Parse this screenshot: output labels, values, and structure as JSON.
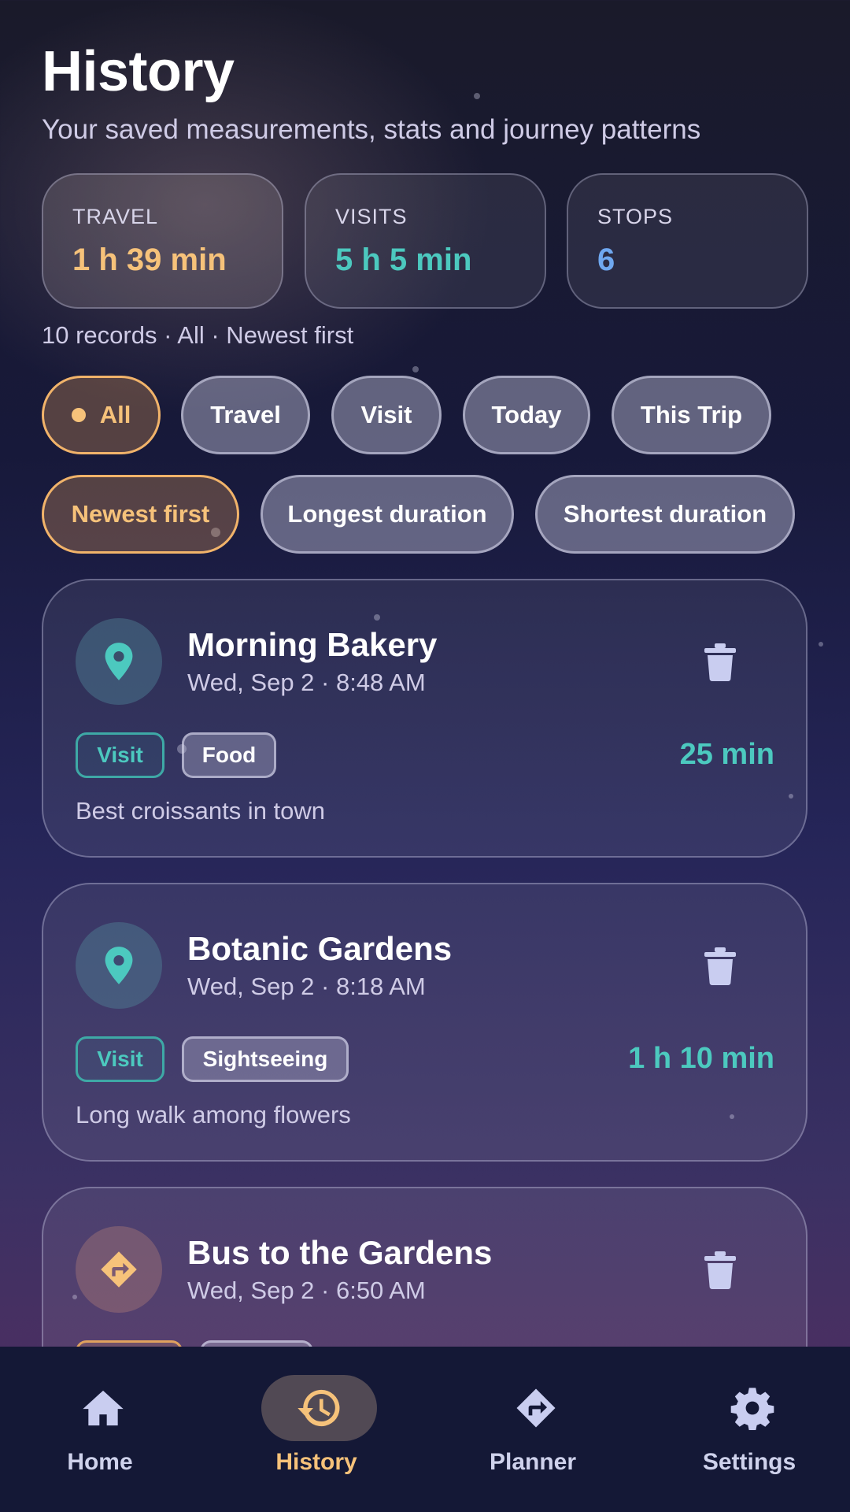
{
  "header": {
    "title": "History",
    "subtitle": "Your saved measurements, stats and journey patterns"
  },
  "stats": [
    {
      "label": "TRAVEL",
      "value": "1 h 39 min",
      "color": "#f6c27a"
    },
    {
      "label": "VISITS",
      "value": "5 h 5 min",
      "color": "#4cc9bf"
    },
    {
      "label": "STOPS",
      "value": "6",
      "color": "#6fa8f0"
    }
  ],
  "summary": "10 records · All · Newest first",
  "filters": {
    "type_chips": [
      "All",
      "Travel",
      "Visit",
      "Today",
      "This Trip"
    ],
    "type_selected": "All",
    "sort_chips": [
      "Newest first",
      "Longest duration",
      "Shortest duration"
    ],
    "sort_selected": "Newest first"
  },
  "records": [
    {
      "title": "Morning Bakery",
      "date": "Wed, Sep 2 · 8:48 AM",
      "kind": "Visit",
      "category": "Food",
      "duration": "25 min",
      "note": "Best croissants in town",
      "icon": "location-pin-icon"
    },
    {
      "title": "Botanic Gardens",
      "date": "Wed, Sep 2 · 8:18 AM",
      "kind": "Visit",
      "category": "Sightseeing",
      "duration": "1 h 10 min",
      "note": "Long walk among flowers",
      "icon": "location-pin-icon"
    },
    {
      "title": "Bus to the Gardens",
      "date": "Wed, Sep 2 · 6:50 AM",
      "kind": "Travel",
      "category": "",
      "duration": "",
      "note": "",
      "icon": "directions-icon"
    }
  ],
  "nav": {
    "items": [
      {
        "label": "Home",
        "icon": "home-icon"
      },
      {
        "label": "History",
        "icon": "history-icon"
      },
      {
        "label": "Planner",
        "icon": "directions-icon"
      },
      {
        "label": "Settings",
        "icon": "gear-icon"
      }
    ],
    "active": "History"
  },
  "colors": {
    "accent_orange": "#f6c27a",
    "accent_teal": "#4cc9bf",
    "accent_blue": "#6fa8f0"
  }
}
